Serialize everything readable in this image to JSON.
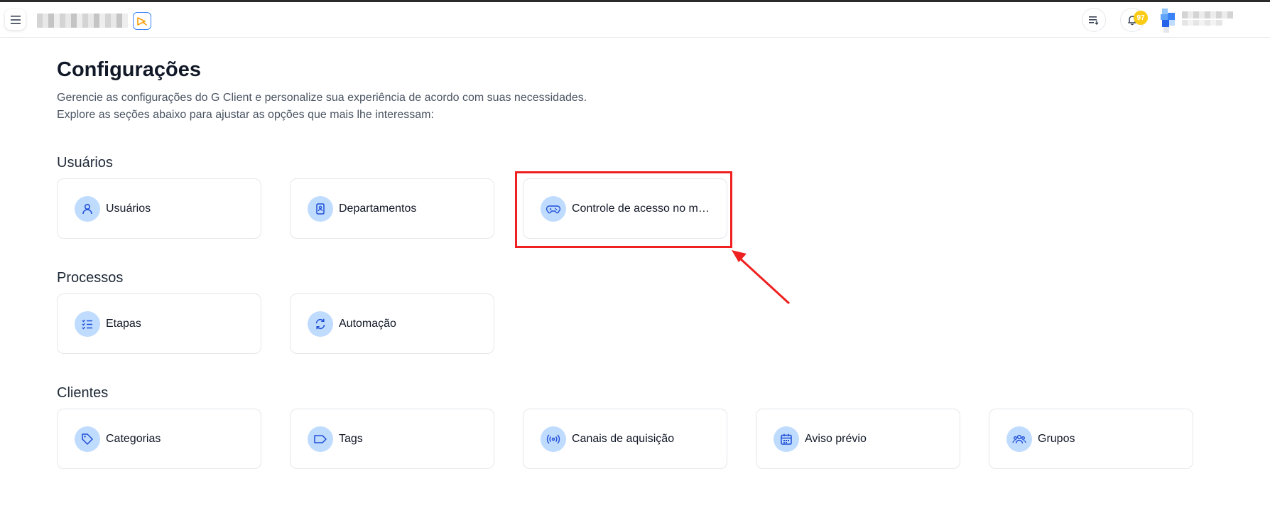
{
  "header": {
    "menu_icon": "hamburger-icon",
    "logo_badge_icon": "play-cursor-icon",
    "list_icon": "list-sort-icon",
    "bell_icon": "bell-icon",
    "notification_count": "97",
    "colors": {
      "accent": "#3b82f6",
      "badge": "#facc15"
    }
  },
  "page": {
    "title": "Configurações",
    "description_line1": "Gerencie as configurações do G Client e personalize sua experiência de acordo com suas necessidades.",
    "description_line2": "Explore as seções abaixo para ajustar as opções que mais lhe interessam:"
  },
  "sections": [
    {
      "title": "Usuários",
      "cards": [
        {
          "label": "Usuários",
          "icon": "user-icon"
        },
        {
          "label": "Departamentos",
          "icon": "building-icon"
        },
        {
          "label": "Controle de acesso no m…",
          "icon": "gamepad-icon"
        }
      ]
    },
    {
      "title": "Processos",
      "cards": [
        {
          "label": "Etapas",
          "icon": "checklist-icon"
        },
        {
          "label": "Automação",
          "icon": "refresh-icon"
        }
      ]
    },
    {
      "title": "Clientes",
      "cards": [
        {
          "label": "Categorias",
          "icon": "tag-icon"
        },
        {
          "label": "Tags",
          "icon": "label-icon"
        },
        {
          "label": "Canais de aquisição",
          "icon": "broadcast-icon"
        },
        {
          "label": "Aviso prévio",
          "icon": "calendar-icon"
        },
        {
          "label": "Grupos",
          "icon": "users-icon"
        }
      ]
    }
  ],
  "annotation": {
    "color": "#ef2020"
  }
}
